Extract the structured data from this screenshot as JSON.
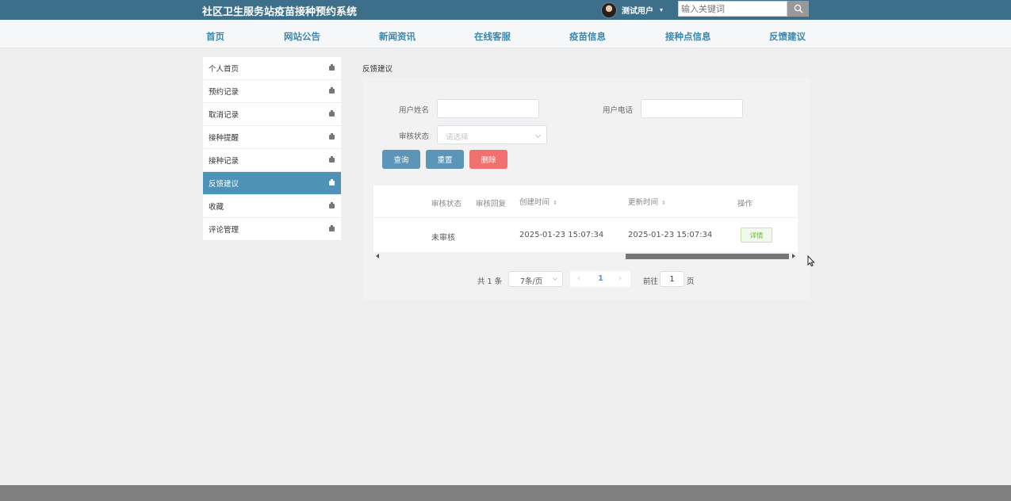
{
  "header": {
    "site_title": "社区卫生服务站疫苗接种预约系统",
    "user_name": "测试用户",
    "user_caret": "▾",
    "search_placeholder": "输入关键词",
    "search_icon": "search-icon"
  },
  "nav": {
    "items": [
      "首页",
      "网站公告",
      "新闻资讯",
      "在线客服",
      "疫苗信息",
      "接种点信息",
      "反馈建议"
    ]
  },
  "sidebar": {
    "items": [
      {
        "label": "个人首页"
      },
      {
        "label": "预约记录"
      },
      {
        "label": "取消记录"
      },
      {
        "label": "接种提醒"
      },
      {
        "label": "接种记录"
      },
      {
        "label": "反馈建议",
        "active": true
      },
      {
        "label": "收藏"
      },
      {
        "label": "评论管理"
      }
    ]
  },
  "main": {
    "breadcrumb": "反馈建议",
    "form": {
      "username_label": "用户姓名",
      "username_value": "",
      "phone_label": "用户电话",
      "phone_value": "",
      "status_label": "审核状态",
      "status_placeholder": "请选择"
    },
    "buttons": {
      "query": "查询",
      "reset": "重置",
      "delete": "删除"
    },
    "table": {
      "headers": [
        "审核状态",
        "审核回复",
        "创建时间",
        "更新时间",
        "操作"
      ],
      "sort_icon": "⇕",
      "rows": [
        {
          "status": "未审核",
          "reply": "",
          "created": "2025-01-23 15:07:34",
          "updated": "2025-01-23 15:07:34",
          "action": "详情"
        }
      ]
    },
    "pagination": {
      "total": "共 1 条",
      "page_size": "7条/页",
      "prev": "‹",
      "current_page": "1",
      "next": "›",
      "goto_label": "前往",
      "goto_value": "1",
      "page_suffix": "页"
    }
  },
  "colors": {
    "topbar": "#3d6f8a",
    "nav_text": "#3d87ad",
    "active_side": "#4f92b7",
    "primary_btn": "#5b96b8",
    "danger_btn": "#f07070"
  }
}
